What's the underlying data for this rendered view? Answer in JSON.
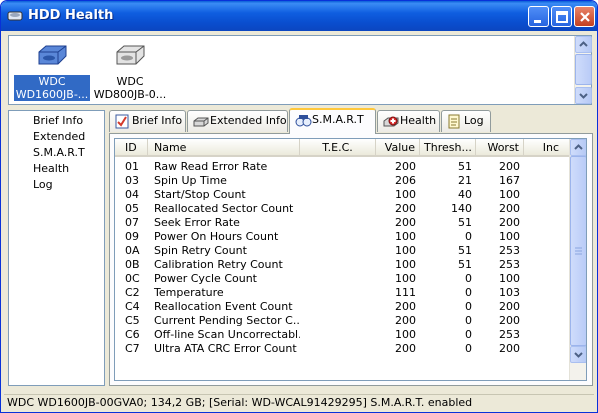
{
  "window": {
    "title": "HDD Health"
  },
  "drives": [
    {
      "label_line1": "WDC",
      "label_line2": "WD1600JB-...",
      "selected": true
    },
    {
      "label_line1": "WDC",
      "label_line2": "WD800JB-0...",
      "selected": false
    }
  ],
  "nav": {
    "items": [
      "Brief Info",
      "Extended",
      "S.M.A.R.T",
      "Health",
      "Log"
    ]
  },
  "tabs": [
    {
      "label": "Brief Info",
      "icon": "brief-info-icon"
    },
    {
      "label": "Extended Info",
      "icon": "drive-icon"
    },
    {
      "label": "S.M.A.R.T",
      "icon": "smart-icon",
      "active": true
    },
    {
      "label": "Health",
      "icon": "health-icon"
    },
    {
      "label": "Log",
      "icon": "log-icon"
    }
  ],
  "smart_table": {
    "columns": [
      "ID",
      "Name",
      "T.E.C.",
      "Value",
      "Thresh...",
      "Worst",
      "Inc"
    ],
    "rows": [
      [
        "01",
        "Raw Read Error Rate",
        "",
        "200",
        "51",
        "200",
        ""
      ],
      [
        "03",
        "Spin Up Time",
        "",
        "206",
        "21",
        "167",
        ""
      ],
      [
        "04",
        "Start/Stop Count",
        "",
        "100",
        "40",
        "100",
        ""
      ],
      [
        "05",
        "Reallocated Sector Count",
        "",
        "200",
        "140",
        "200",
        ""
      ],
      [
        "07",
        "Seek Error Rate",
        "",
        "200",
        "51",
        "200",
        ""
      ],
      [
        "09",
        "Power On Hours Count",
        "",
        "100",
        "0",
        "100",
        ""
      ],
      [
        "0A",
        "Spin Retry Count",
        "",
        "100",
        "51",
        "253",
        ""
      ],
      [
        "0B",
        "Calibration Retry Count",
        "",
        "100",
        "51",
        "253",
        ""
      ],
      [
        "0C",
        "Power Cycle Count",
        "",
        "100",
        "0",
        "100",
        ""
      ],
      [
        "C2",
        "Temperature",
        "",
        "111",
        "0",
        "103",
        ""
      ],
      [
        "C4",
        "Reallocation Event Count",
        "",
        "200",
        "0",
        "200",
        ""
      ],
      [
        "C5",
        "Current Pending Sector C...",
        "",
        "200",
        "0",
        "200",
        ""
      ],
      [
        "C6",
        "Off-line Scan Uncorrectabl...",
        "",
        "100",
        "0",
        "253",
        ""
      ],
      [
        "C7",
        "Ultra ATA CRC Error Count",
        "",
        "200",
        "0",
        "200",
        ""
      ]
    ]
  },
  "status": {
    "text": "WDC WD1600JB-00GVA0;  134,2 GB;  [Serial: WD-WCAL91429295]   S.M.A.R.T. enabled"
  },
  "colors": {
    "title_bar": "#0a5fd7",
    "selection": "#316ac5",
    "active_tab_accent": "#ffc83c"
  }
}
